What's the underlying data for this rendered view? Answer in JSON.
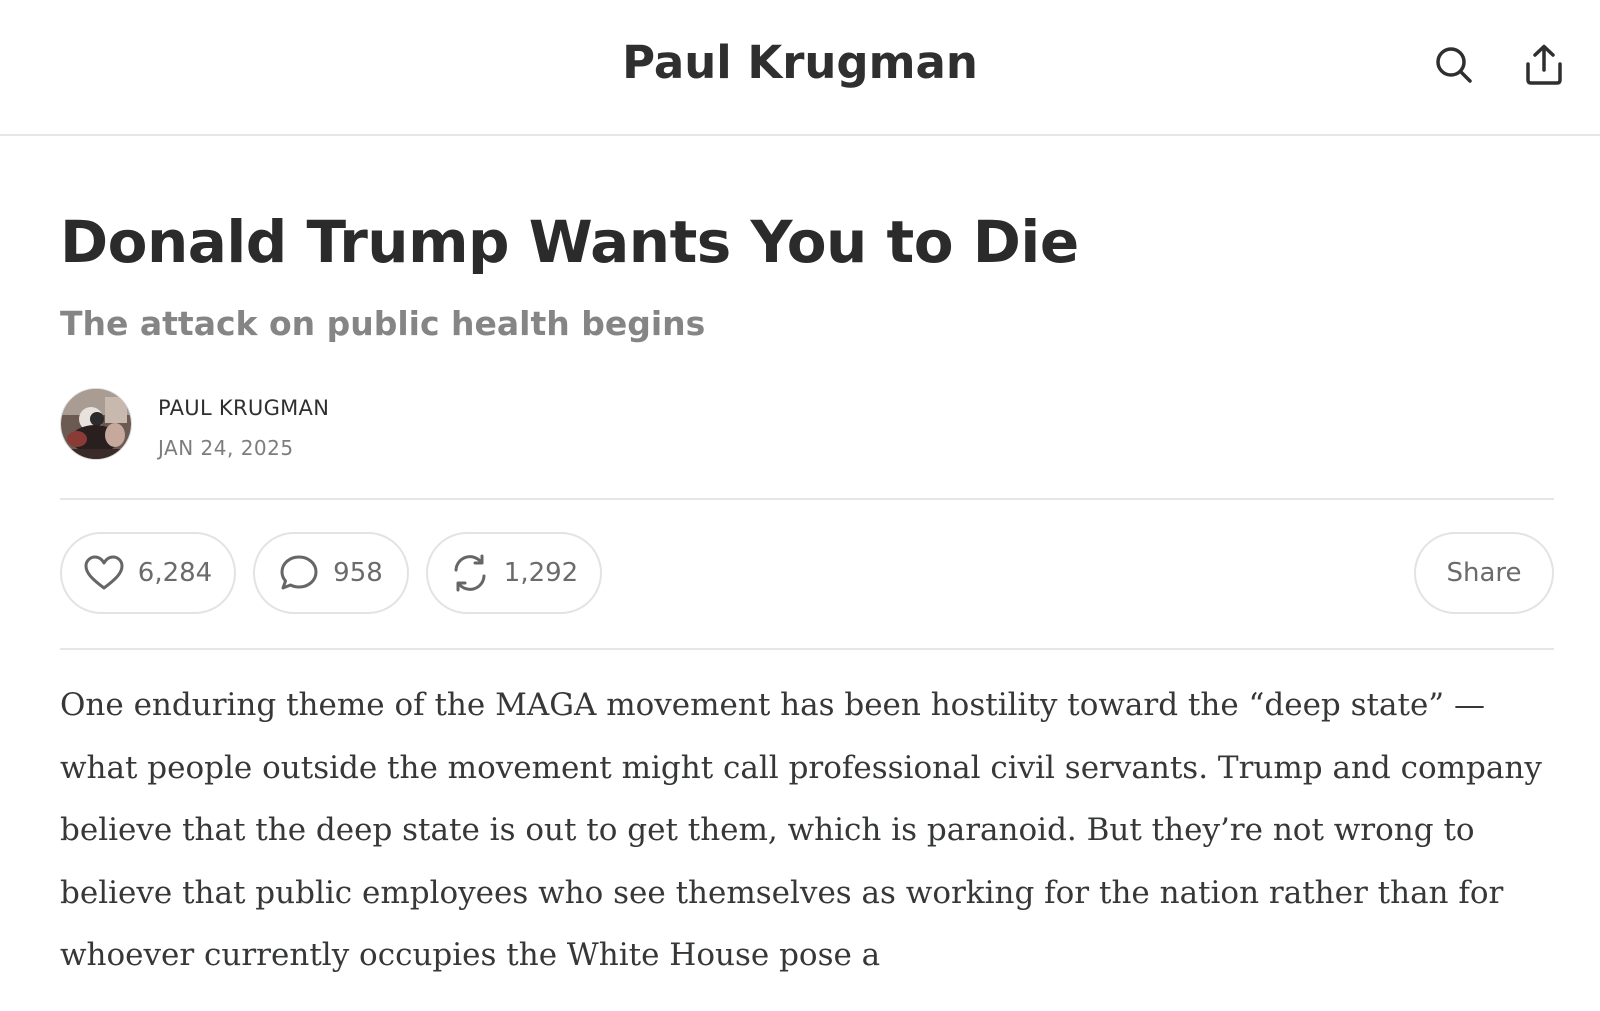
{
  "header": {
    "publication_title": "Paul Krugman",
    "icons": [
      "search-icon",
      "share-icon"
    ]
  },
  "post": {
    "title": "Donald Trump Wants You to Die",
    "subtitle": "The attack on public health begins",
    "author": "PAUL KRUGMAN",
    "date": "JAN 24, 2025"
  },
  "actions": {
    "likes": "6,284",
    "comments": "958",
    "restacks": "1,292",
    "share_label": "Share"
  },
  "body": {
    "paragraph": "One enduring theme of the MAGA movement has been hostility toward the “deep state” — what people outside the movement might call professional civil servants. Trump and company believe that the deep state is out to get them, which is paranoid. But they’re not wrong to believe that public employees who see themselves as working for the nation rather than for whoever currently occupies the White House pose a"
  },
  "colors": {
    "text": "#363737",
    "muted": "#858585",
    "border": "#e6e6e6"
  }
}
